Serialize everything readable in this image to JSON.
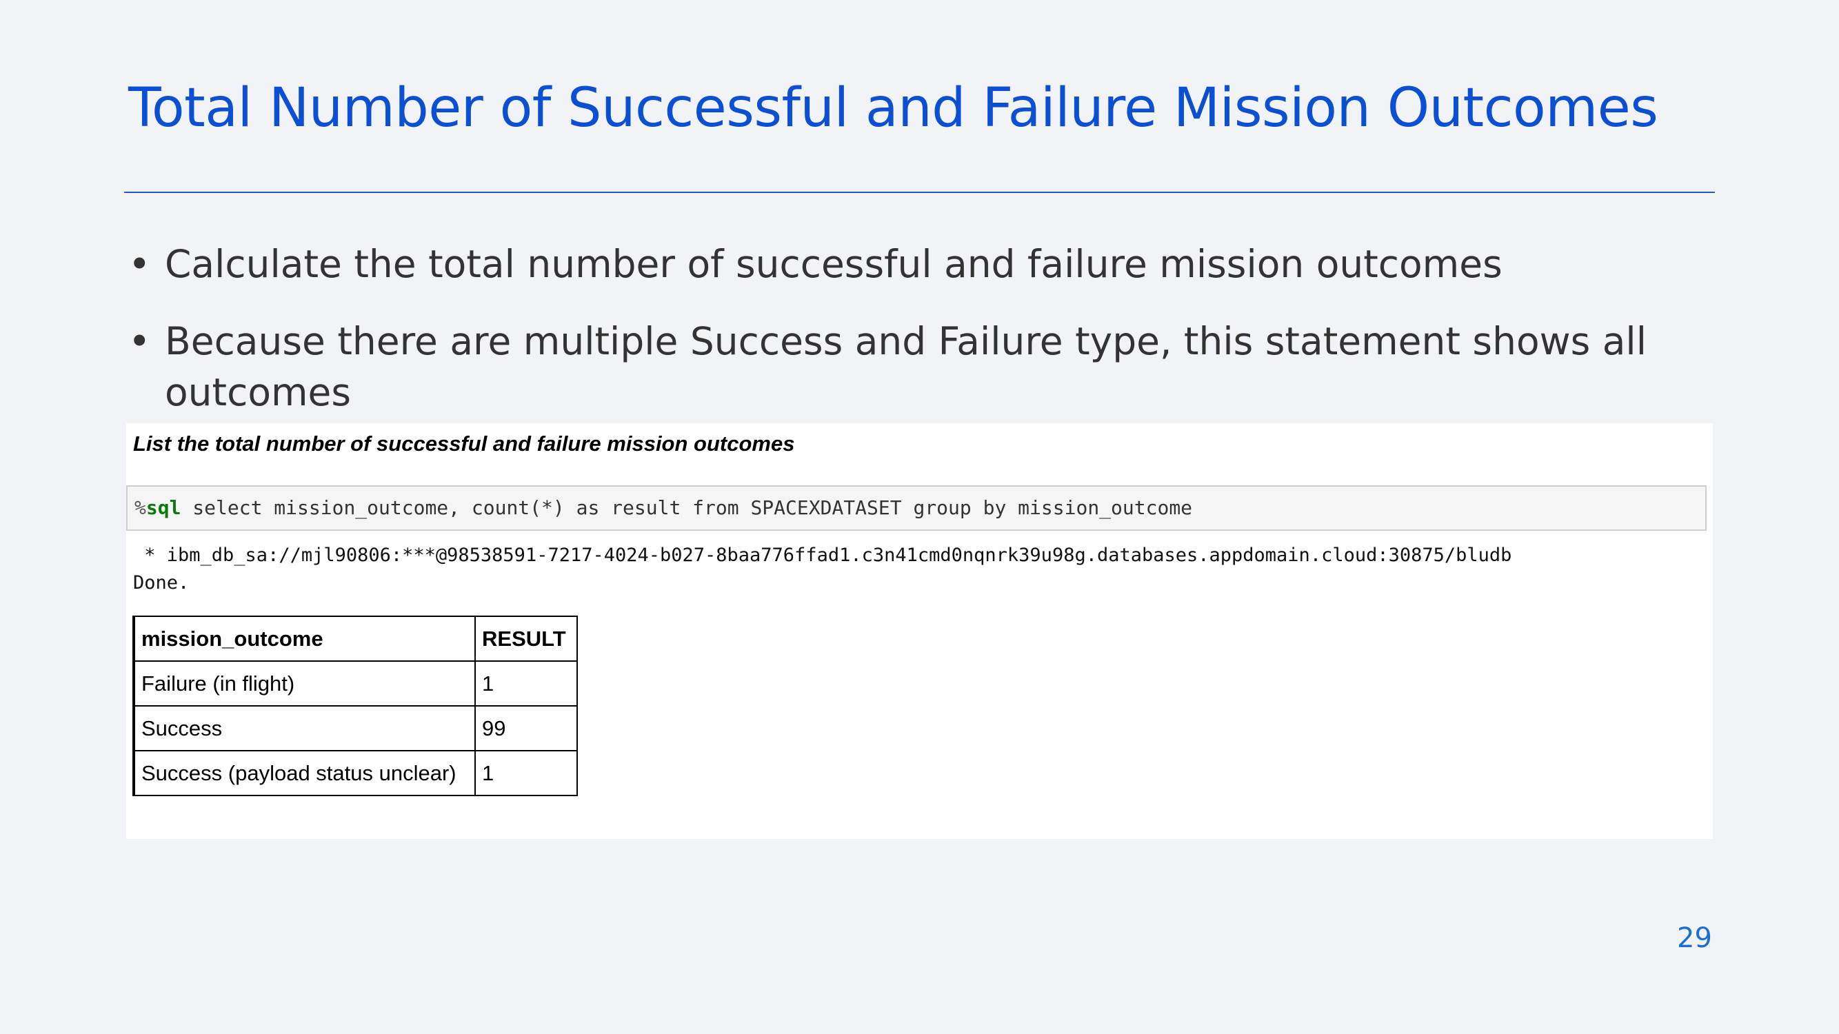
{
  "slide": {
    "title": "Total Number of Successful and Failure Mission Outcomes",
    "bullets": [
      "Calculate the total number of successful and failure mission outcomes",
      "Because there are multiple Success and Failure type, this statement shows all outcomes"
    ],
    "bullet_glyph": "•",
    "page_number": "29"
  },
  "notebook": {
    "heading": "List the total number of successful and failure mission outcomes",
    "code": {
      "magic_prefix": "%",
      "magic_keyword": "sql",
      "query": " select mission_outcome, count(*) as result from SPACEXDATASET group by mission_outcome"
    },
    "output_connection": " * ibm_db_sa://mjl90806:***@98538591-7217-4024-b027-8baa776ffad1.c3n41cmd0nqnrk39u98g.databases.appdomain.cloud:30875/bludb",
    "output_status": "Done.",
    "table": {
      "headers": [
        "mission_outcome",
        "RESULT"
      ],
      "rows": [
        [
          "Failure (in flight)",
          "1"
        ],
        [
          "Success",
          "99"
        ],
        [
          "Success (payload status unclear)",
          "1"
        ]
      ]
    }
  },
  "colors": {
    "title": "#0b4fd3",
    "rule": "#1e5bc6",
    "sql_keyword": "#0a7a0a",
    "page_number": "#1a6fd0"
  }
}
